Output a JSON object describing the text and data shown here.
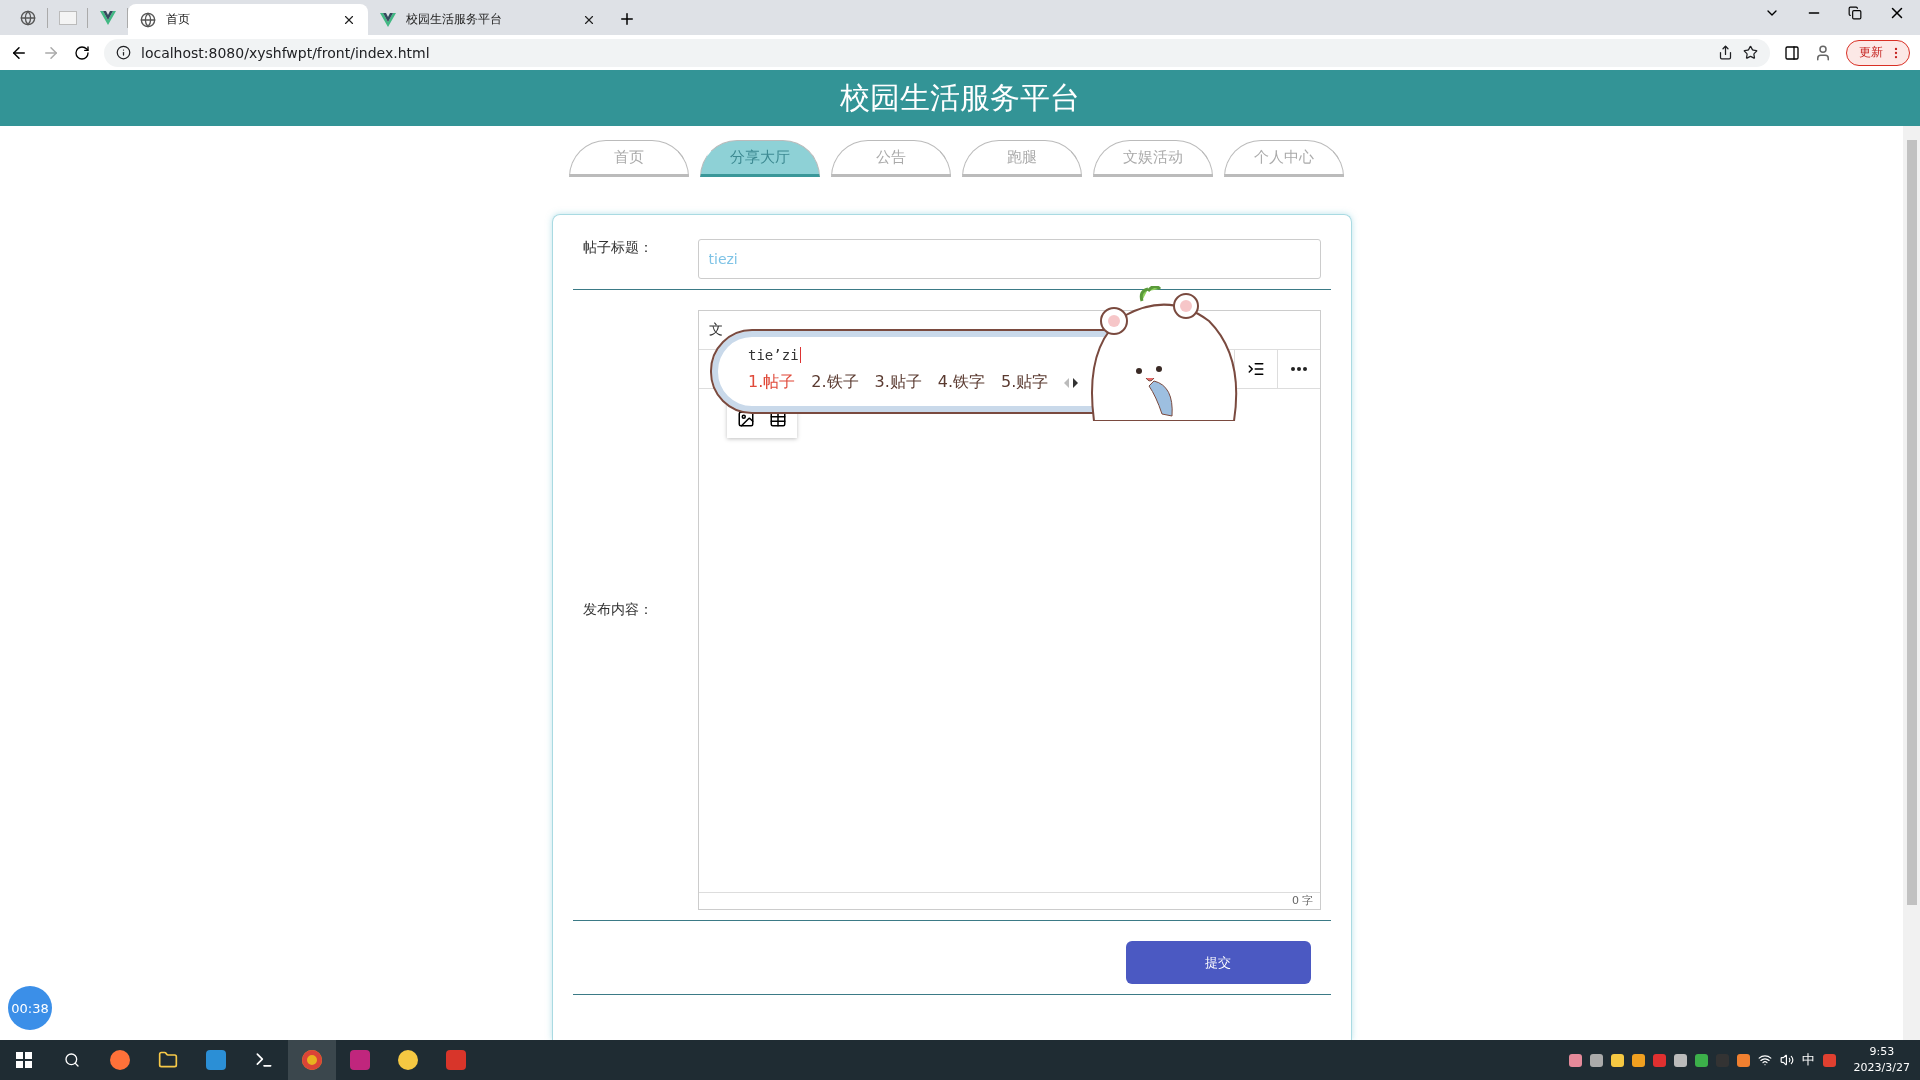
{
  "browser": {
    "pinned_tabs": [
      {
        "kind": "globe"
      },
      {
        "kind": "blank"
      },
      {
        "kind": "vue"
      }
    ],
    "tabs": [
      {
        "title": "首页",
        "kind": "globe",
        "selected": true
      },
      {
        "title": "校园生活服务平台",
        "kind": "vue",
        "selected": false
      }
    ],
    "url": "localhost:8080/xyshfwpt/front/index.html",
    "update_button": "更新"
  },
  "header": {
    "title": "校园生活服务平台"
  },
  "nav": [
    {
      "label": "首页",
      "selected": false
    },
    {
      "label": "分享大厅",
      "selected": true
    },
    {
      "label": "公告",
      "selected": false
    },
    {
      "label": "跑腿",
      "selected": false
    },
    {
      "label": "文娱活动",
      "selected": false
    },
    {
      "label": "个人中心",
      "selected": false
    }
  ],
  "form": {
    "title_label": "帖子标题：",
    "title_value": "tiezi",
    "content_label": "发布内容：",
    "editor": {
      "menu_partial": "文",
      "word_count": "0 字"
    },
    "submit": "提交"
  },
  "ime": {
    "composition": "tie’zi",
    "candidates": [
      {
        "text": "1.帖子",
        "selected": true
      },
      {
        "text": "2.铁子",
        "selected": false
      },
      {
        "text": "3.贴子",
        "selected": false
      },
      {
        "text": "4.铁字",
        "selected": false
      },
      {
        "text": "5.贴字",
        "selected": false
      }
    ]
  },
  "timer": "00:38",
  "taskbar": {
    "ime_indicator": "中",
    "time": "9:53",
    "date": "2023/3/27"
  }
}
